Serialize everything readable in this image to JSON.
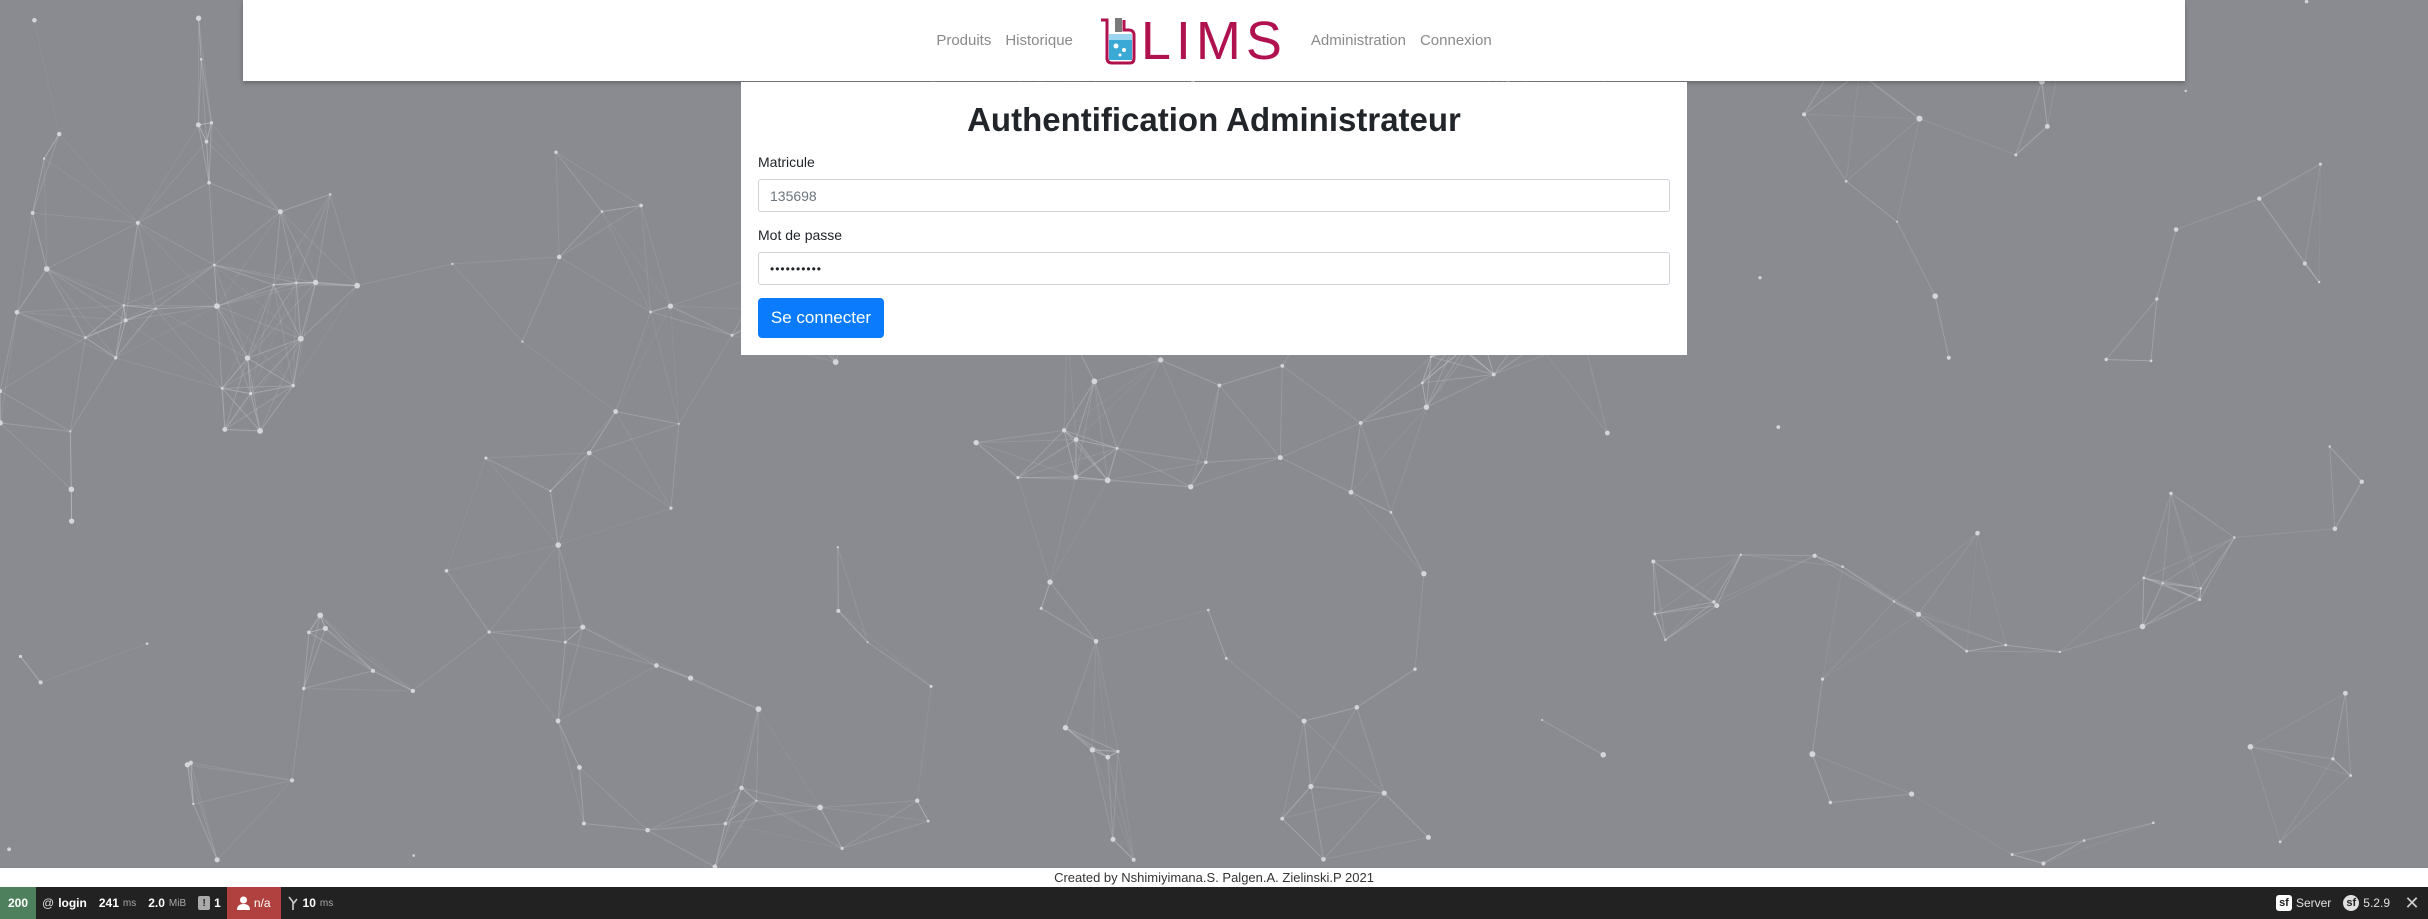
{
  "nav": {
    "left": [
      "Produits",
      "Historique"
    ],
    "logo_text": "LIMS",
    "right": [
      "Administration",
      "Connexion"
    ]
  },
  "login": {
    "title": "Authentification Administrateur",
    "matricule_label": "Matricule",
    "matricule_value": "135698",
    "password_label": "Mot de passe",
    "password_value": "••••••••••",
    "submit_label": "Se connecter"
  },
  "footer": {
    "credit": "Created by Nshimiyimana.S. Palgen.A. Zielinski.P 2021"
  },
  "debug_toolbar": {
    "status_code": "200",
    "route": "login",
    "time_value": "241",
    "time_unit": "ms",
    "memory_value": "2.0",
    "memory_unit": "MiB",
    "logs_count": "1",
    "user": "n/a",
    "twig_value": "10",
    "twig_unit": "ms",
    "server_label": "Server",
    "version": "5.2.9"
  },
  "colors": {
    "brand": "#b0124f",
    "primary_button": "#0a7bfd",
    "background": "#898b90",
    "status_ok": "#4f805d",
    "user_badge": "#b0413e"
  }
}
